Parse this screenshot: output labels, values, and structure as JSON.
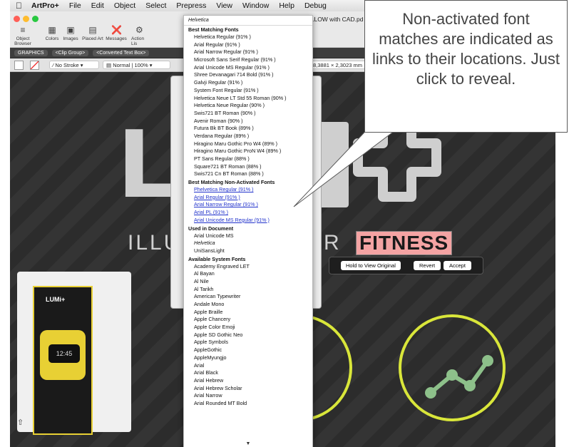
{
  "menubar": {
    "app_name": "ArtPro+",
    "items": [
      "File",
      "Edit",
      "Object",
      "Select",
      "Prepress",
      "View",
      "Window",
      "Help",
      "Debug"
    ]
  },
  "window_title": "S_YELLOW with CAD.pd",
  "toolbar": {
    "items": [
      "Object Browser",
      "Colors",
      "Images",
      "Placed Art",
      "Messages",
      "Action Lis"
    ]
  },
  "pathbar": {
    "crumbs": [
      "GRAPHICS",
      "<Clip Group>",
      "<Converted Text Box>"
    ]
  },
  "props": {
    "stroke": "No Stroke",
    "blend": "Normal",
    "opacity": "100%",
    "dimensions": "8,3881 × 2,3023 mm"
  },
  "artwork": {
    "tagline_left": "ILLU",
    "tagline_mid": "R",
    "highlight_word": "FITNESS",
    "buttons": {
      "hold": "Hold to View Original",
      "revert": "Revert",
      "accept": "Accept"
    },
    "package_brand": "LUMi+",
    "package_time": "12:45"
  },
  "fontmenu": {
    "search": "Helvetica",
    "best_header": "Best Matching Fonts",
    "best": [
      "Helvetica Regular (91% )",
      "Arial Regular (91% )",
      "Arial Narrow Regular (91% )",
      "Microsoft Sans Serif Regular (91% )",
      "Arial Unicode MS Regular (91% )",
      "Shree Devanagari 714 Bold (91% )",
      "Galvji Regular (91% )",
      "System Font Regular (91% )",
      "Helvetica Neue LT Std 55 Roman (90% )",
      "Helvetica Neue Regular (90% )",
      "Swis721 BT Roman (90% )",
      "Avenir Roman (90% )",
      "Futura Bk BT Book (89% )",
      "Verdana Regular (89% )",
      "Hiragino Maru Gothic Pro W4 (89% )",
      "Hiragino Maru Gothic ProN W4 (89% )",
      "PT Sans Regular (88% )",
      "Square721 BT Roman (88% )",
      "Swis721 Cn BT Roman (88% )"
    ],
    "nonact_header": "Best Matching Non-Activated Fonts",
    "nonact": [
      "Phelvetica Regular (91% )",
      "Arial Regular (91% )",
      "Arial Narrow Regular (91% )",
      "Arial PL (91% )",
      "Arial Unicode MS Regular (91% )"
    ],
    "used_header": "Used in Document",
    "used": [
      "Arial Unicode MS",
      "Helvetica",
      "UniSansLight"
    ],
    "system_header": "Available System Fonts",
    "system": [
      "Academy Engraved LET",
      "Al Bayan",
      "Al Nile",
      "Al Tarikh",
      "American Typewriter",
      "Andale Mono",
      "Apple Braille",
      "Apple Chancery",
      "Apple Color Emoji",
      "Apple SD Gothic Neo",
      "Apple Symbols",
      "AppleGothic",
      "AppleMyungjo",
      "Arial",
      "Arial Black",
      "Arial Hebrew",
      "Arial Hebrew Scholar",
      "Arial Narrow",
      "Arial Rounded MT Bold"
    ],
    "scroll_arrow": "▼"
  },
  "callout": {
    "text": "Non-activated font matches are indicated as links to their locations. Just click to reveal."
  },
  "colors": {
    "highlight_bg": "#f4a3a3",
    "link": "#2233cc",
    "ring": "#d9e63a",
    "accent_green": "#8dc08a"
  }
}
